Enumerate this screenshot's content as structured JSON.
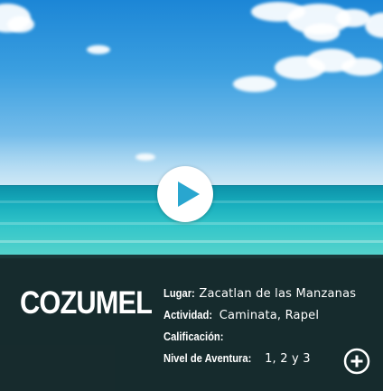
{
  "card": {
    "title": "COZUMEL",
    "fields": [
      {
        "label": "Lugar:",
        "value": "Zacatlan de las Manzanas"
      },
      {
        "label": "Actividad:",
        "value": "Caminata, Rapel"
      },
      {
        "label": "Calificación:",
        "value": ""
      },
      {
        "label": "Nivel de Aventura:",
        "value": "1, 2 y 3"
      }
    ]
  },
  "icons": {
    "play": "play-icon",
    "more": "plus-circle-icon"
  },
  "colors": {
    "overlay": "#162a2c",
    "text": "#ffffff",
    "play_triangle": "#29a6cf"
  }
}
